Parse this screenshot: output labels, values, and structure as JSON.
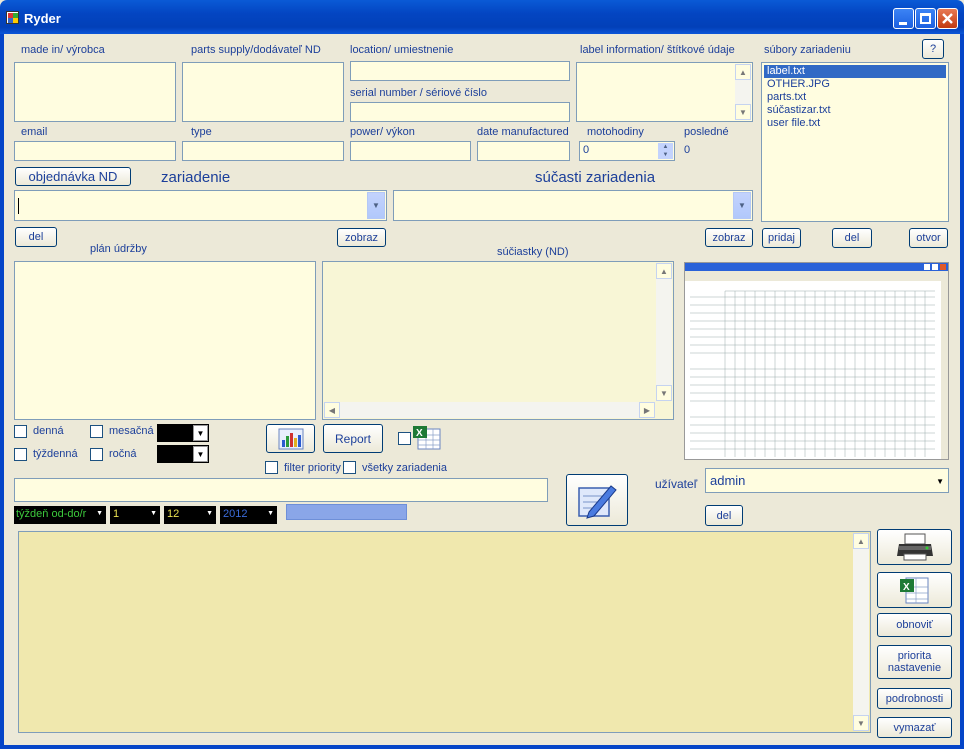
{
  "window": {
    "title": "Ryder"
  },
  "labels": {
    "made_in": "made in/ výrobca",
    "parts_supply": "parts supply/dodávateľ ND",
    "location": "location/ umiestnenie",
    "serial_number": "serial number / sériové číslo",
    "label_info": "label information/ štítkové údaje",
    "device_files": "súbory zariadeniu",
    "email": "email",
    "type": "type",
    "power": "power/ výkon",
    "date_manufactured": "date manufactured",
    "motohodiny": "motohodiny",
    "posledne": "posledné",
    "posledne_value": "0",
    "zariadenie": "zariadenie",
    "sucasti": "súčasti zariadenia",
    "plan_udrzby": "plán údržby",
    "suciastky": "súčiastky (ND)",
    "uzivatel": "užívateľ"
  },
  "buttons": {
    "help": "?",
    "objednavka": "objednávka ND",
    "del1": "del",
    "zobraz1": "zobraz",
    "zobraz2": "zobraz",
    "pridaj": "pridaj",
    "del2": "del",
    "otvor": "otvor",
    "report": "Report",
    "del_user": "del",
    "obnovit": "obnoviť",
    "priorita": "priorita nastavenie",
    "podrobnosti": "podrobnosti",
    "vymazat": "vymazať"
  },
  "inputs": {
    "motohodiny_value": "0",
    "user_value": "admin",
    "week_label": "týždeň od-do/r",
    "week_from": "1",
    "week_to": "12",
    "year": "2012"
  },
  "files": [
    "label.txt",
    "OTHER.JPG",
    "parts.txt",
    "súčastizar.txt",
    "user file.txt"
  ],
  "checkboxes": {
    "denna": "denná",
    "mesacna": "mesačná",
    "tyzdenna": "týždenná",
    "rocna": "ročná",
    "filter_priority": "filter priority",
    "vsetky": "všetky zariadenia"
  },
  "colors": {
    "title_bar": "#0345c2",
    "field_bg": "#fffde0",
    "log_bg": "#f0e8ae",
    "label_text": "#1c3f9a",
    "form_bg": "#ece9d8"
  },
  "icons": [
    "chart-icon",
    "excel-icon",
    "edit-icon",
    "printer-icon",
    "excel-export-icon"
  ]
}
